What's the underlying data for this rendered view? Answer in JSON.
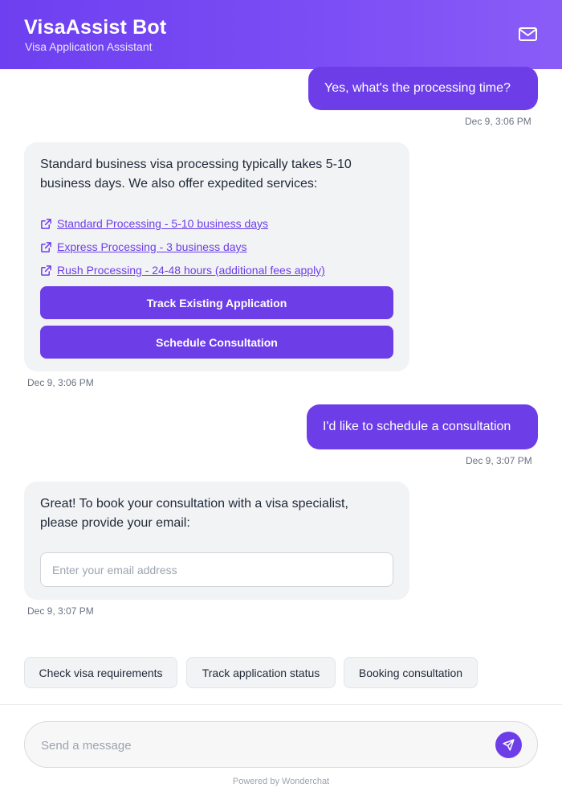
{
  "header": {
    "title": "VisaAssist Bot",
    "subtitle": "Visa Application Assistant",
    "mail_icon": "mail-icon"
  },
  "messages": [
    {
      "role": "user",
      "text": "Yes, what's the processing time?",
      "time": "Dec 9, 3:06 PM"
    },
    {
      "role": "bot",
      "text": "Standard business visa processing typically takes 5-10 business days. We also offer expedited services:",
      "links": [
        "Standard Processing - 5-10 business days",
        "Express Processing - 3 business days",
        "Rush Processing - 24-48 hours (additional fees apply)"
      ],
      "buttons": [
        "Track Existing Application",
        "Schedule Consultation"
      ],
      "time": "Dec 9, 3:06 PM"
    },
    {
      "role": "user",
      "text": "I'd like to schedule a consultation",
      "time": "Dec 9, 3:07 PM"
    },
    {
      "role": "bot",
      "text": "Great! To book your consultation with a visa specialist, please provide your email:",
      "input_placeholder": "Enter your email address",
      "time": "Dec 9, 3:07 PM"
    }
  ],
  "quick_replies": [
    "Check visa requirements",
    "Track application status",
    "Booking consultation"
  ],
  "composer": {
    "placeholder": "Send a message",
    "send_icon": "send-icon"
  },
  "footer": {
    "powered_by": "Powered by Wonderchat"
  },
  "colors": {
    "accent": "#6d3ee8",
    "bot_bubble": "#f2f3f5"
  }
}
